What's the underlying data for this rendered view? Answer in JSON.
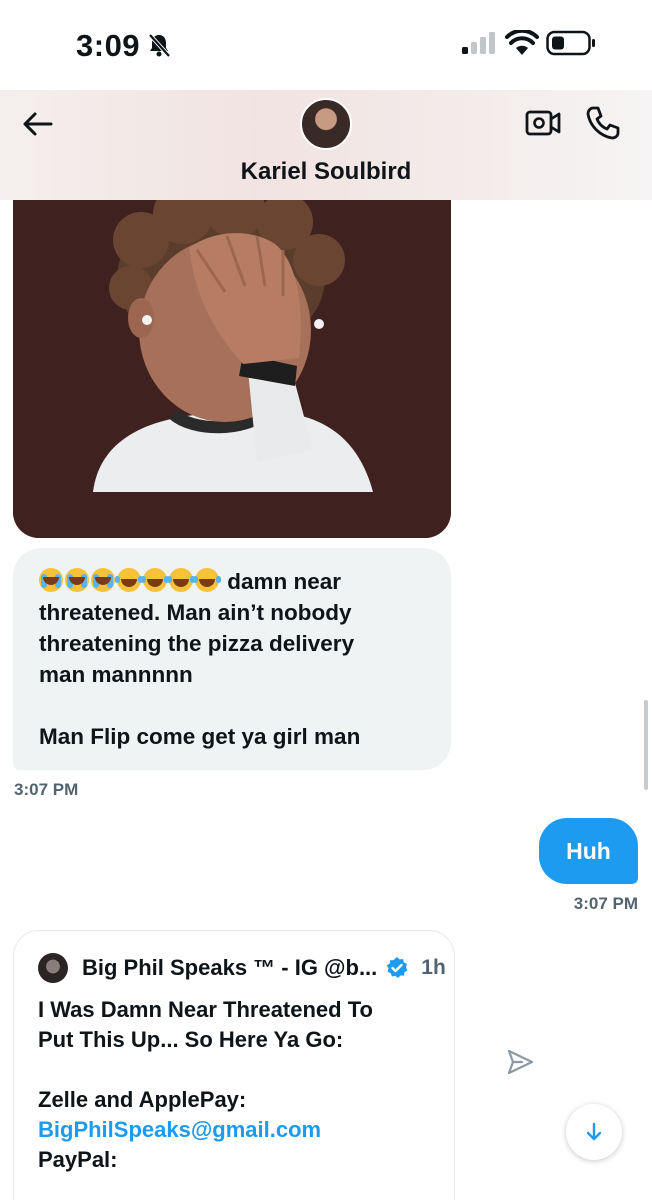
{
  "status_bar": {
    "time": "3:09",
    "icons": [
      "bell-slash-icon",
      "signal-icon",
      "wifi-icon",
      "battery-icon"
    ]
  },
  "header": {
    "contact_name": "Kariel Soulbird",
    "icons": [
      "back-arrow-icon",
      "video-call-icon",
      "phone-call-icon"
    ]
  },
  "conversation": {
    "image_message": {
      "icon": "facepalm-memoji"
    },
    "incoming_message": {
      "lines": [
        "damn near",
        "threatened. Man ain’t nobody",
        "threatening the pizza delivery",
        "man mannnnn",
        "Man Flip come get ya girl man"
      ],
      "emojis": [
        "crying",
        "crying",
        "crying",
        "laughing",
        "laughing",
        "laughing",
        "laughing"
      ],
      "time": "3:07 PM"
    },
    "outgoing_message": {
      "text": "Huh",
      "time": "3:07 PM"
    },
    "shared_post": {
      "author": "Big Phil Speaks ™ - IG @b...",
      "verified": true,
      "age": "1h",
      "lines": [
        "I Was Damn Near Threatened To",
        "Put This Up... So Here Ya Go:",
        "Zelle and ApplePay:",
        "BigPhilSpeaks@gmail.com",
        "PayPal:"
      ]
    }
  },
  "colors": {
    "accent": "#1d9bf0",
    "incoming_bubble": "#eff3f4",
    "memoji_background": "#3f2220",
    "secondary_text": "#536471"
  }
}
